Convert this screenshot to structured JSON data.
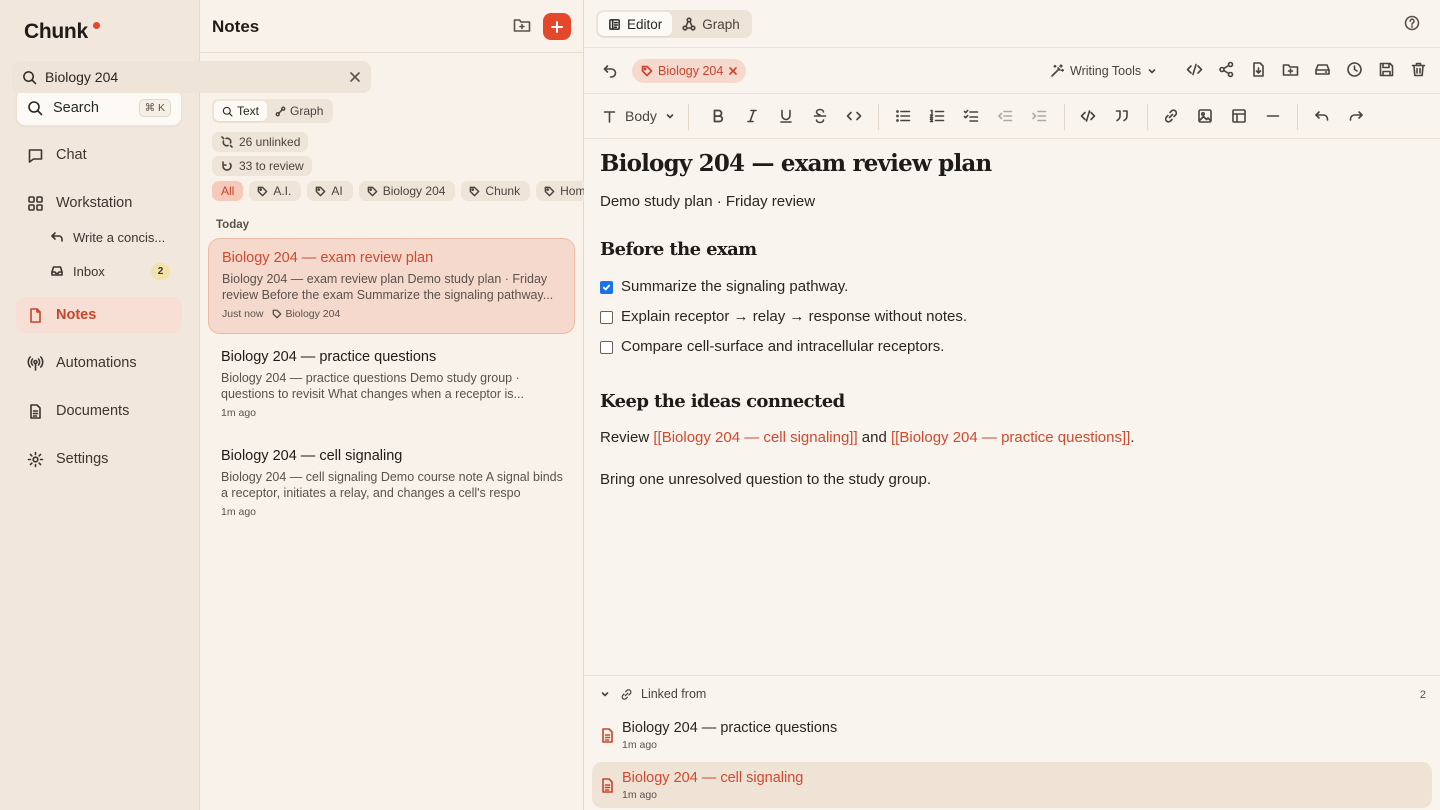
{
  "app": {
    "name": "Chunk",
    "brand_color": "#e5472a"
  },
  "sidebar": {
    "search_label": "Search",
    "search_shortcut": "⌘ K",
    "items": [
      {
        "label": "Chat",
        "icon": "chat-icon"
      },
      {
        "label": "Workstation",
        "icon": "grid-icon"
      },
      {
        "label": "Notes",
        "icon": "note-icon",
        "active": true
      },
      {
        "label": "Automations",
        "icon": "broadcast-icon"
      },
      {
        "label": "Documents",
        "icon": "document-icon"
      },
      {
        "label": "Settings",
        "icon": "gear-icon"
      }
    ],
    "workstation_children": [
      {
        "label": "Write a concis...",
        "icon": "reply-icon"
      },
      {
        "label": "Inbox",
        "icon": "inbox-icon",
        "badge": "2"
      }
    ]
  },
  "notes_panel": {
    "title": "Notes",
    "search_value": "Biology 204",
    "search_modes": [
      "Text",
      "Graph"
    ],
    "unlinked_label": "26 unlinked",
    "review_label": "33 to review",
    "tags": [
      "All",
      "A.I.",
      "AI",
      "Biology 204",
      "Chunk",
      "Home B"
    ],
    "section_label": "Today",
    "notes": [
      {
        "title": "Biology 204 — exam review plan",
        "snippet": "Biology 204 — exam review plan Demo study plan · Friday review Before the exam Summarize the signaling pathway...",
        "time": "Just now",
        "tag": "Biology 204"
      },
      {
        "title": "Biology 204 — practice questions",
        "snippet": "Biology 204 — practice questions Demo study group · questions to revisit What changes when a receptor is...",
        "time": "1m ago"
      },
      {
        "title": "Biology 204 — cell signaling",
        "snippet": "Biology 204 — cell signaling Demo course note A signal binds a receptor, initiates a relay, and changes a cell's respo",
        "time": "1m ago"
      }
    ]
  },
  "editor": {
    "views": [
      "Editor",
      "Graph"
    ],
    "note_tag": "Biology 204",
    "writing_tools_label": "Writing Tools",
    "block_style": "Body",
    "doc": {
      "title": "Biology 204 — exam review plan",
      "subtitle": "Demo study plan · Friday review",
      "section1": "Before the exam",
      "tasks": [
        {
          "text": "Summarize the signaling pathway.",
          "checked": true
        },
        {
          "text": "Explain receptor → relay → response without notes.",
          "checked": false
        },
        {
          "text": "Compare cell-surface and intracellular receptors.",
          "checked": false
        }
      ],
      "section2": "Keep the ideas connected",
      "review_prefix": "Review ",
      "link1": "[[Biology 204 — cell signaling]]",
      "review_and": " and ",
      "link2": "[[Biology 204 — practice questions]]",
      "review_suffix": ".",
      "closing": "Bring one unresolved question to the study group."
    },
    "linked_from": {
      "label": "Linked from",
      "count": "2",
      "items": [
        {
          "title": "Biology 204 — practice questions",
          "time": "1m ago"
        },
        {
          "title": "Biology 204 — cell signaling",
          "time": "1m ago"
        }
      ]
    }
  }
}
